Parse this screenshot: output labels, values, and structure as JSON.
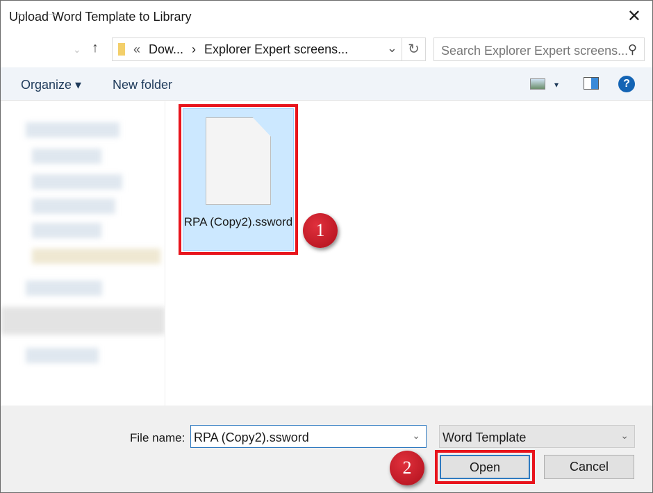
{
  "window": {
    "title": "Upload Word Template to Library",
    "close": "✕"
  },
  "nav": {
    "back": "←",
    "forward": "→",
    "recent": "⌄",
    "up": "↑",
    "breadcrumb_overflow": "«",
    "crumbs": [
      "Dow...",
      "Explorer Expert screens..."
    ],
    "separator": "›",
    "refresh": "↻",
    "dropdown": "⌄"
  },
  "search": {
    "placeholder": "Search Explorer Expert screens...",
    "icon": "search-icon"
  },
  "toolbar": {
    "organize": "Organize ▾",
    "new_folder": "New folder",
    "view_caret": "▾",
    "help": "?"
  },
  "files": [
    {
      "name": "RPA (Copy2).ssword",
      "type": "file-icon",
      "selected": true
    }
  ],
  "annotations": [
    "1",
    "2"
  ],
  "footer": {
    "file_name_label": "File name:",
    "file_name_value": "RPA (Copy2).ssword",
    "file_type": "Word Template",
    "open": "Open",
    "cancel": "Cancel",
    "dropdown": "⌄"
  },
  "colors": {
    "highlight": "#e8141c",
    "selection": "#cce8ff",
    "accent": "#2f7ac0"
  }
}
